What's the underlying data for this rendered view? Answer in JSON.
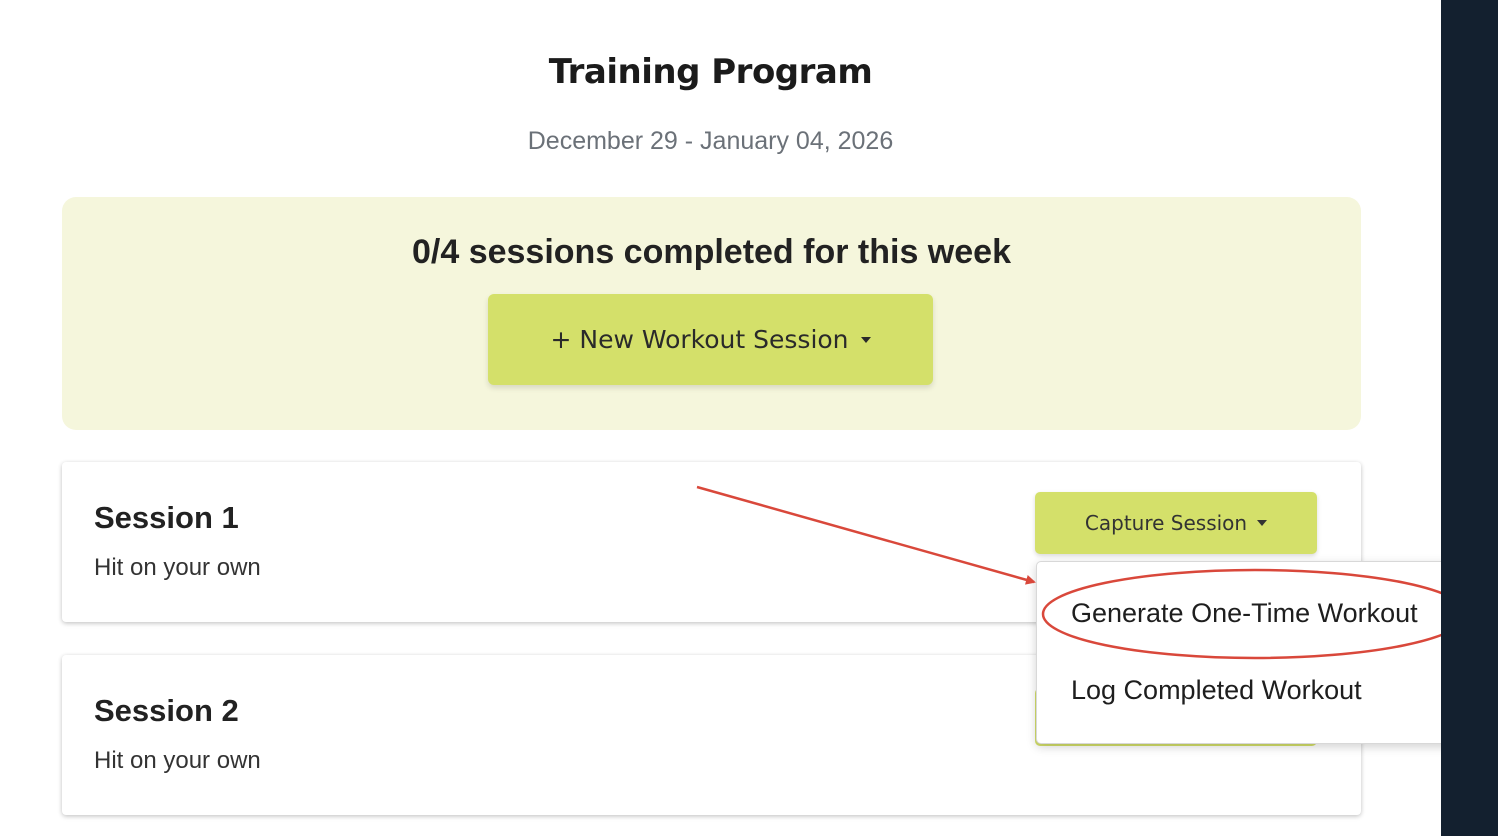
{
  "header": {
    "title": "Training Program",
    "date_range": "December 29 - January 04, 2026"
  },
  "summary": {
    "text": "0/4 sessions completed for this week",
    "new_session_label": "+ New Workout Session"
  },
  "sessions": [
    {
      "title": "Session 1",
      "subtitle": "Hit on your own",
      "action_label": "Capture Session"
    },
    {
      "title": "Session 2",
      "subtitle": "Hit on your own"
    }
  ],
  "dropdown": {
    "items": [
      {
        "label": "Generate One-Time Workout"
      },
      {
        "label": "Log Completed Workout"
      }
    ]
  },
  "colors": {
    "accent": "#d4e06a",
    "summary_bg": "#f5f6dc",
    "rail": "#13202f",
    "annotation": "#d9483b"
  }
}
